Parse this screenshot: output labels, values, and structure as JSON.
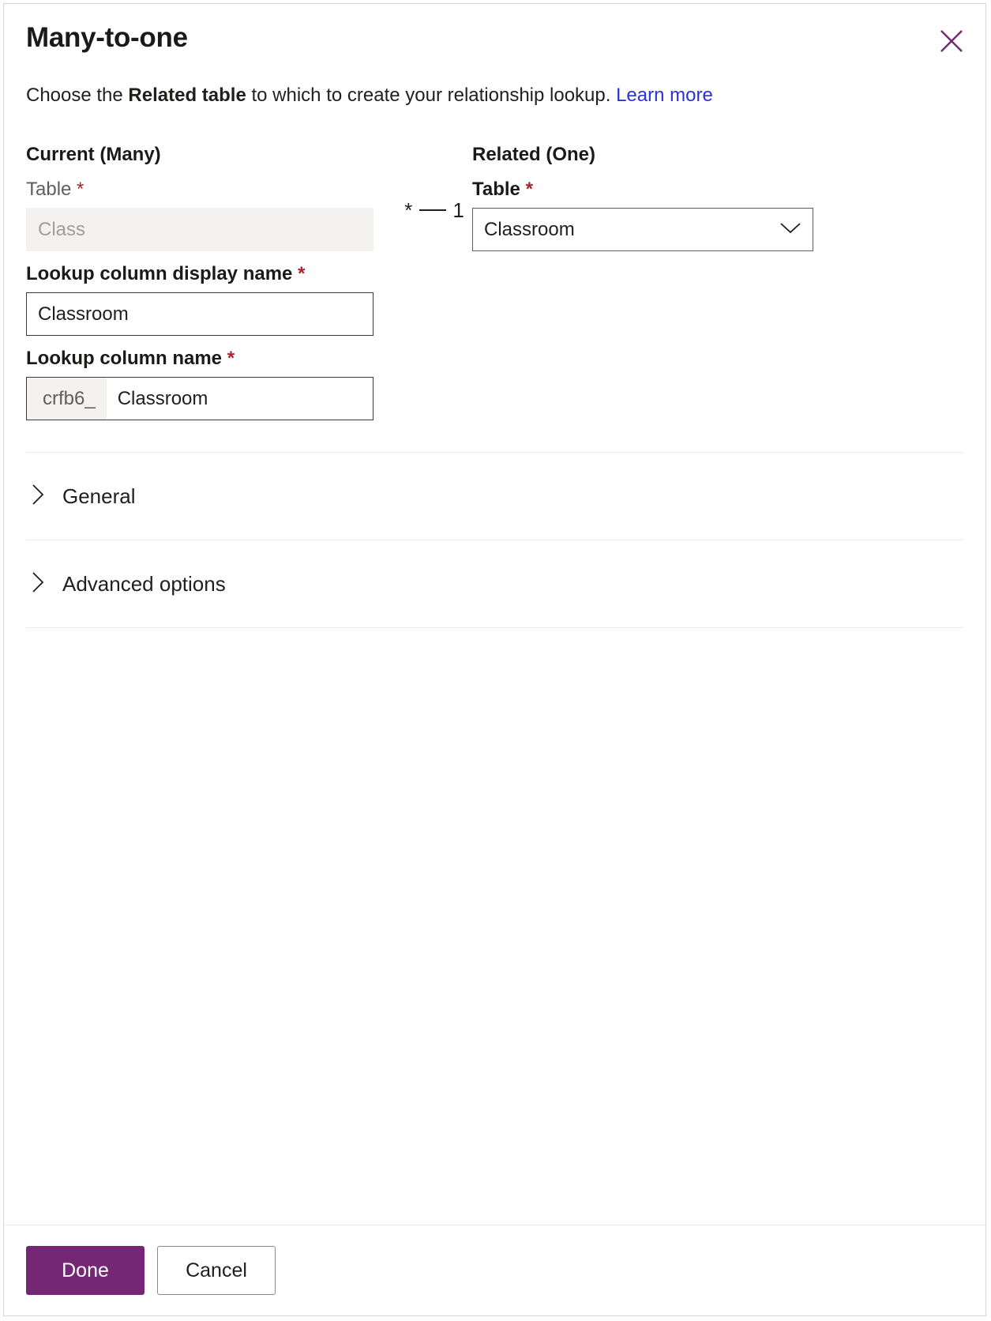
{
  "dialog": {
    "title": "Many-to-one",
    "close_icon": "close-icon",
    "description": {
      "prefix": "Choose the ",
      "bold": "Related table",
      "suffix": " to which to create your relationship lookup. ",
      "link": "Learn more"
    }
  },
  "current": {
    "heading": "Current (Many)",
    "table_label": "Table",
    "required_marker": "*",
    "table_value": "Class"
  },
  "cardinality": {
    "many": "*",
    "one": "1"
  },
  "related": {
    "heading": "Related (One)",
    "table_label": "Table",
    "required_marker": "*",
    "table_value": "Classroom",
    "chevron_icon": "chevron-down-icon"
  },
  "lookup_display_name": {
    "label": "Lookup column display name",
    "required_marker": "*",
    "value": "Classroom"
  },
  "lookup_name": {
    "label": "Lookup column name",
    "required_marker": "*",
    "prefix": "crfb6_",
    "value": "Classroom"
  },
  "sections": [
    {
      "label": "General",
      "chevron_icon": "chevron-right-icon",
      "expanded": false
    },
    {
      "label": "Advanced options",
      "chevron_icon": "chevron-right-icon",
      "expanded": false
    }
  ],
  "footer": {
    "done_label": "Done",
    "cancel_label": "Cancel"
  },
  "colors": {
    "accent": "#742774",
    "link": "#2b31d8",
    "required": "#a4262c",
    "disabled_bg": "#f3f2f1"
  }
}
